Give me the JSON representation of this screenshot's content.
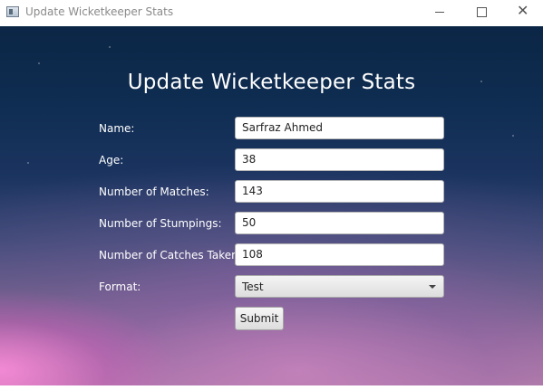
{
  "window": {
    "title": "Update Wicketkeeper Stats",
    "close_glyph": "✕"
  },
  "form": {
    "title": "Update Wicketkeeper Stats",
    "fields": [
      {
        "label": "Name:",
        "value": "Sarfraz Ahmed"
      },
      {
        "label": "Age:",
        "value": "38"
      },
      {
        "label": "Number of Matches:",
        "value": "143"
      },
      {
        "label": "Number of Stumpings:",
        "value": "50"
      },
      {
        "label": "Number of Catches Taken:",
        "value": "108"
      }
    ],
    "format": {
      "label": "Format:",
      "selected": "Test"
    },
    "submit_label": "Submit"
  }
}
